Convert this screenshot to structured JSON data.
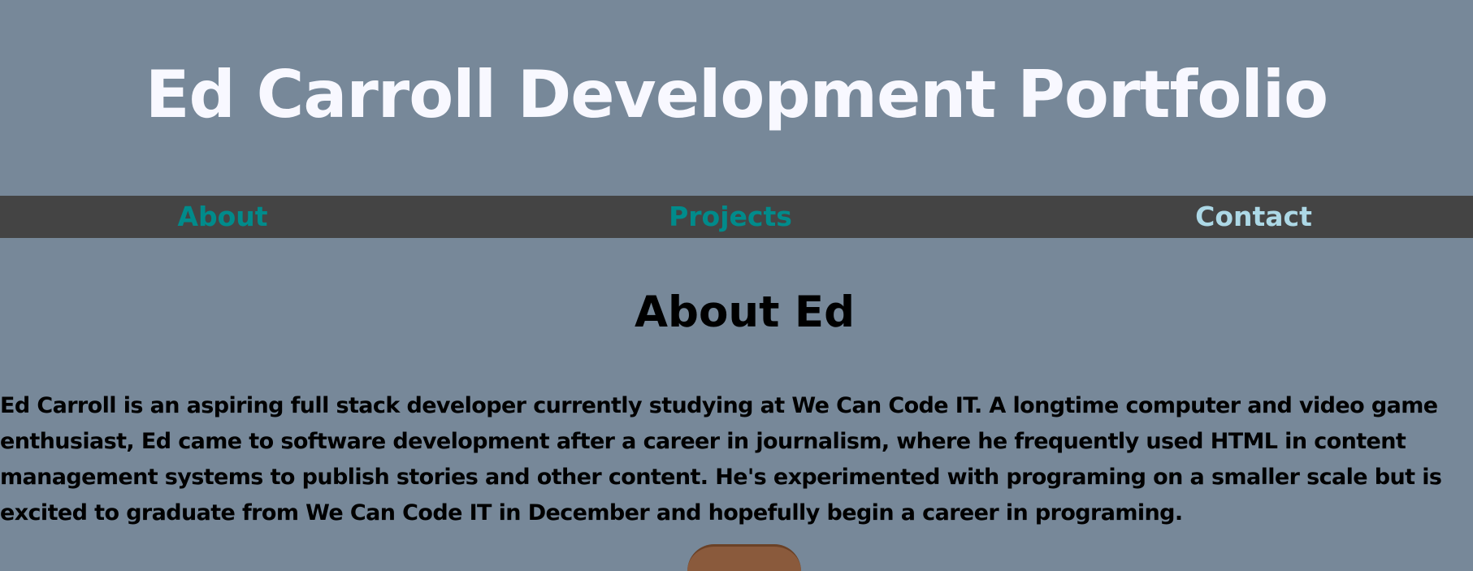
{
  "header": {
    "title": "Ed Carroll Development Portfolio"
  },
  "nav": {
    "items": [
      {
        "label": "About"
      },
      {
        "label": "Projects"
      },
      {
        "label": "Contact"
      }
    ]
  },
  "about": {
    "heading": "About Ed",
    "body": "Ed Carroll is an aspiring full stack developer currently studying at We Can Code IT. A longtime computer and video game enthusiast, Ed came to software development after a career in journalism, where he frequently used HTML in content management systems to publish stories and other content. He's experimented with programing on a smaller scale but is excited to graduate from We Can Code IT in December and hopefully begin a career in programing."
  },
  "colors": {
    "background": "#778899",
    "nav_background": "#444444",
    "nav_link": "#008b8b",
    "nav_link_active": "#add8e6",
    "title_text": "#f8f8ff"
  }
}
